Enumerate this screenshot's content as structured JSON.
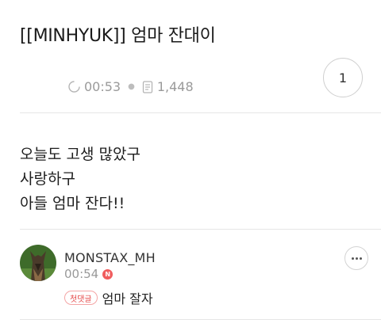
{
  "post": {
    "title": "[[MINHYUK]] 엄마 잔대이",
    "duration": "00:53",
    "views": "1,448",
    "like_count": "1",
    "body_lines": [
      "오늘도 고생 많았구",
      "사랑하구",
      "아들 엄마 잔다!!"
    ]
  },
  "comment": {
    "author": "MONSTAX_MH",
    "time": "00:54",
    "new_badge": "N",
    "tag": "첫댓글",
    "text": "엄마 잘자"
  },
  "icons": {
    "duration": "clock-icon",
    "views": "document-icon",
    "more": "more-options-icon",
    "avatar": "avatar-dog"
  },
  "colors": {
    "accent": "#f05d5e",
    "meta": "#9a9a9a",
    "divider": "#e6e6e6"
  }
}
